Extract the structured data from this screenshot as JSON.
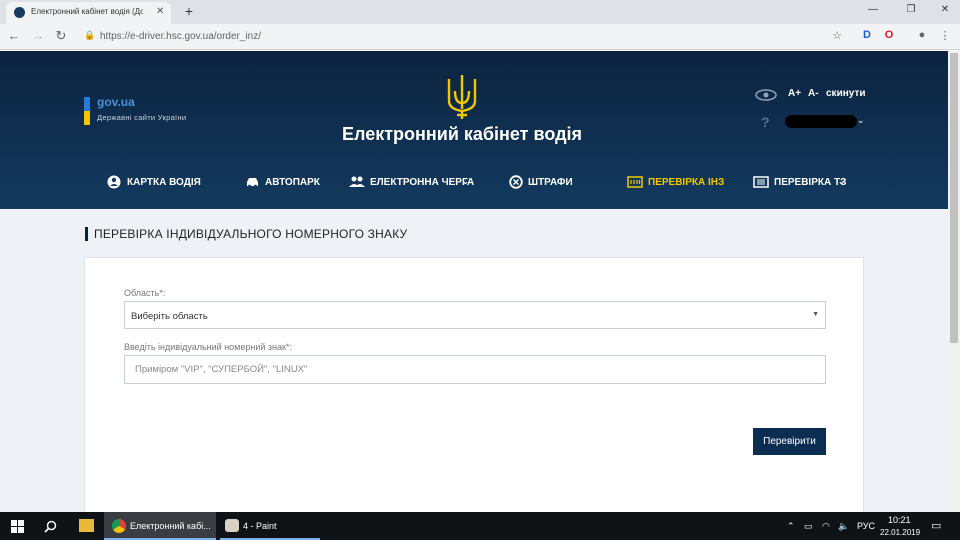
{
  "browser": {
    "tab_title": "Електронний кабінет водія (Дос",
    "url": "https://e-driver.hsc.gov.ua/order_inz/"
  },
  "header": {
    "gov_title": "gov.ua",
    "gov_subtitle": "Державні сайти України",
    "site_title": "Електронний кабінет водія",
    "font_plus": "A+",
    "font_minus": "A-",
    "reset": "скинути",
    "help": "?"
  },
  "nav": {
    "items": [
      {
        "label": "КАРТКА ВОДІЯ",
        "icon": "user-circle-icon"
      },
      {
        "label": "АВТОПАРК",
        "icon": "car-icon"
      },
      {
        "label": "ЕЛЕКТРОННА ЧЕРГА",
        "icon": "people-icon"
      },
      {
        "label": "ШТРАФИ",
        "icon": "fines-icon"
      },
      {
        "label": "ПЕРЕВІРКА ІНЗ",
        "icon": "plate-icon"
      },
      {
        "label": "ПЕРЕВІРКА ТЗ",
        "icon": "document-icon"
      }
    ]
  },
  "page": {
    "section_title": "ПЕРЕВІРКА ІНДИВІДУАЛЬНОГО НОМЕРНОГО ЗНАКУ",
    "region_label": "Область*:",
    "region_value": "Виберіть область",
    "plate_label": "Введіть індивідуальний номерний знак*:",
    "plate_placeholder": "Приміром \"VIP\", \"СУПЕРБОЙ\", \"LINUX\"",
    "check_button": "Перевірити"
  },
  "taskbar": {
    "chrome_label": "Електронний кабі...",
    "paint_label": "4 - Paint",
    "lang": "РУС",
    "time": "10:21",
    "date": "22.01.2019"
  },
  "colors": {
    "header_dark": "#0c2340",
    "accent_yellow": "#f3c700",
    "button": "#0c2d52"
  }
}
